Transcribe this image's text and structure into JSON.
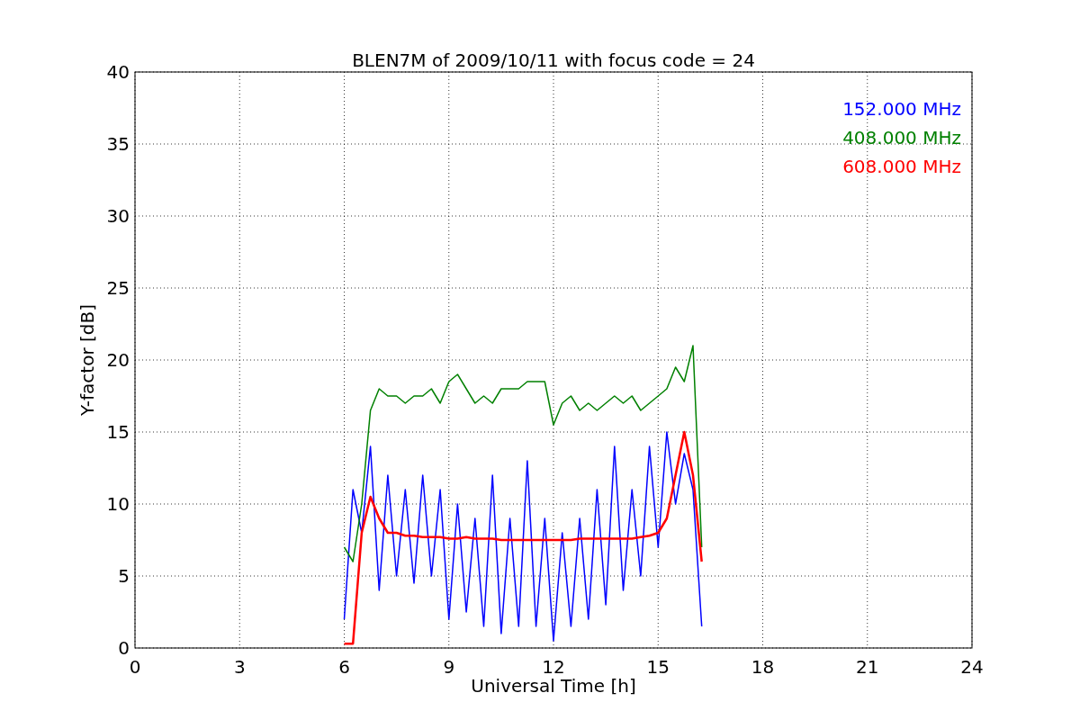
{
  "figure": {
    "chart_data": {
      "type": "line",
      "title": "BLEN7M of 2009/10/11 with focus code = 24",
      "xlabel": "Universal Time [h]",
      "ylabel": "Y-factor [dB]",
      "x": [
        6,
        6.25,
        6.5,
        6.75,
        7,
        7.25,
        7.5,
        7.75,
        8,
        8.25,
        8.5,
        8.75,
        9,
        9.25,
        9.5,
        9.75,
        10,
        10.25,
        10.5,
        10.75,
        11,
        11.25,
        11.5,
        11.75,
        12,
        12.25,
        12.5,
        12.75,
        13,
        13.25,
        13.5,
        13.75,
        14,
        14.25,
        14.5,
        14.75,
        15,
        15.25,
        15.5,
        15.75,
        16,
        16.25
      ],
      "series": [
        {
          "name": "152.000 MHz",
          "color": "#0000ff",
          "values": [
            2,
            11,
            8,
            14,
            4,
            12,
            5,
            11,
            4.5,
            12,
            5,
            11,
            2,
            10,
            2.5,
            9,
            1.5,
            12,
            1,
            9,
            1.5,
            13,
            1.5,
            9,
            0.5,
            8,
            1.5,
            9,
            2,
            11,
            3,
            14,
            4,
            11,
            5,
            14,
            7,
            15,
            10,
            13.5,
            11,
            1.5
          ]
        },
        {
          "name": "408.000 MHz",
          "color": "#008000",
          "values": [
            7,
            6,
            10,
            16.5,
            18,
            17.5,
            17.5,
            17,
            17.5,
            17.5,
            18,
            17,
            18.5,
            19,
            18,
            17,
            17.5,
            17,
            18,
            18,
            18,
            18.5,
            18.5,
            18.5,
            15.5,
            17,
            17.5,
            16.5,
            17,
            16.5,
            17,
            17.5,
            17,
            17.5,
            16.5,
            17,
            17.5,
            18,
            19.5,
            18.5,
            21,
            7
          ]
        },
        {
          "name": "608.000 MHz",
          "color": "#ff0000",
          "values": [
            0.3,
            0.3,
            8,
            10.5,
            9,
            8,
            8,
            7.8,
            7.8,
            7.7,
            7.7,
            7.7,
            7.6,
            7.6,
            7.7,
            7.6,
            7.6,
            7.6,
            7.5,
            7.5,
            7.5,
            7.5,
            7.5,
            7.5,
            7.5,
            7.5,
            7.5,
            7.6,
            7.6,
            7.6,
            7.6,
            7.6,
            7.6,
            7.6,
            7.7,
            7.8,
            8,
            9,
            12,
            15,
            12,
            6
          ]
        }
      ],
      "grid": true,
      "xlim": [
        0,
        24
      ],
      "ylim": [
        0,
        40
      ],
      "xticks": [
        0,
        3,
        6,
        9,
        12,
        15,
        18,
        21,
        24
      ],
      "yticks": [
        0,
        5,
        10,
        15,
        20,
        25,
        30,
        35,
        40
      ]
    }
  }
}
